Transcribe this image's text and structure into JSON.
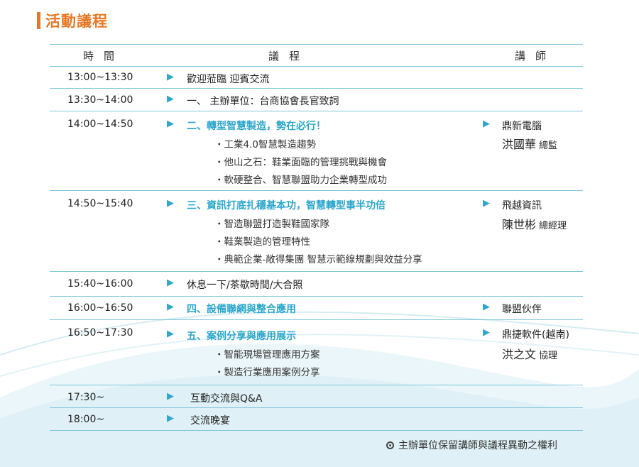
{
  "page": {
    "title": "活動議程"
  },
  "header": {
    "time": "時間",
    "agenda": "議程",
    "speaker": "講師"
  },
  "rows": [
    {
      "time": "13:00~13:30",
      "main": "歡迎蒞臨 迎賓交流"
    },
    {
      "time": "13:30~14:00",
      "main": "一、 主辦單位：台商協會長官致詞"
    },
    {
      "time": "14:00~14:50",
      "main": "二、轉型智慧製造，勢在必行！",
      "subs": [
        "・工業4.0智慧製造趨勢",
        "・他山之石：鞋業面臨的管理挑戰與機會",
        "・軟硬整合、智慧聯盟助力企業轉型成功"
      ],
      "speaker": {
        "company": "鼎新電腦",
        "name": "洪國華",
        "title": "總監"
      }
    },
    {
      "time": "14:50~15:40",
      "main": "三、資訊打底扎穩基本功，智慧轉型事半功倍",
      "subs": [
        "・智造聯盟打造製鞋國家隊",
        "・鞋業製造的管理特性",
        "・典範企業-敞得集團 智慧示範線規劃與效益分享"
      ],
      "speaker": {
        "company": "飛越資訊",
        "name": "陳世彬",
        "title": "總經理"
      }
    },
    {
      "time": "15:40~16:00",
      "main": "休息一下/茶歇時間/大合照"
    },
    {
      "time": "16:00~16:50",
      "main": "四、設備聯網與整合應用",
      "speaker": {
        "company": "聯盟伙伴"
      }
    },
    {
      "time": "16:50~17:30",
      "main": "五、案例分享與應用展示",
      "subs": [
        "・智能現場管理應用方案",
        "・製造行業應用案例分享"
      ],
      "speaker": {
        "company": "鼎捷軟件(越南)",
        "name": "洪之文",
        "title": "協理"
      }
    },
    {
      "time": "17:30~",
      "main": "互動交流與Q&A"
    },
    {
      "time": "18:00~",
      "main": "交流晚宴"
    }
  ],
  "footnote": {
    "text": "主辦單位保留講師與議程異動之權利"
  },
  "colors": {
    "accent": "#e87722",
    "highlight": "#2aa6cc",
    "rule": "#7fc6da"
  },
  "icons": {
    "bullet": "play-arrow-icon",
    "note": "circle-mark-icon"
  }
}
